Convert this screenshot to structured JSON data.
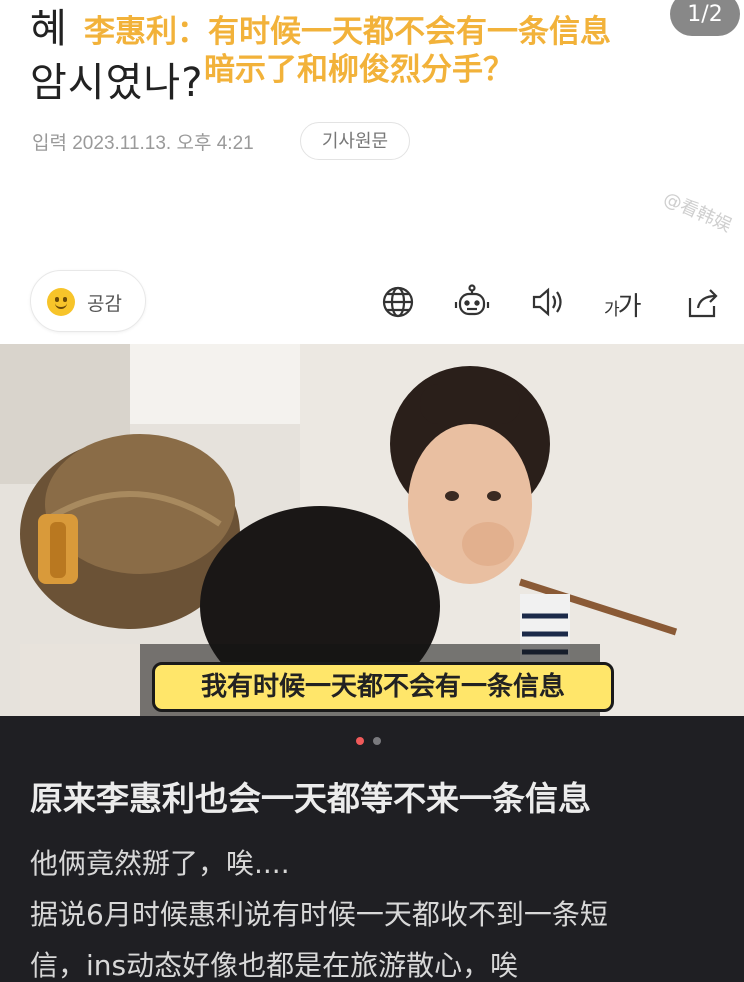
{
  "article": {
    "headline_line1_fragment": "혜",
    "headline_line2": "암시였나?",
    "caption_line1": "李惠利：有时候一天都不会有一条信息",
    "caption_line2": "暗示了和柳俊烈分手？",
    "page_indicator": "1/2",
    "date": "입력 2023.11.13. 오후 4:21",
    "source_button": "기사원문",
    "watermark": "@看韩娱",
    "empathy_label": "공감",
    "font_size_label_small": "가",
    "font_size_label_large": "가"
  },
  "toolbar": {
    "icons": [
      "globe-icon",
      "robot-icon",
      "speaker-icon",
      "font-size-icon",
      "share-icon"
    ]
  },
  "photo": {
    "subtitle": "我有时候一天都不会有一条信息"
  },
  "carousel": {
    "active_index": 1,
    "total": 2
  },
  "post": {
    "title": "原来李惠利也会一天都等不来一条信息",
    "body_lines": [
      "他俩竟然掰了，唉....",
      "据说6月时候惠利说有时候一天都收不到一条短",
      "信，ins动态好像也都是在旅游散心，唉"
    ]
  },
  "colors": {
    "caption_yellow": "#f2b23a",
    "dark_bg": "#1f1f23",
    "dot_active": "#f05a5a",
    "subtitle_bg": "#ffe66a"
  }
}
